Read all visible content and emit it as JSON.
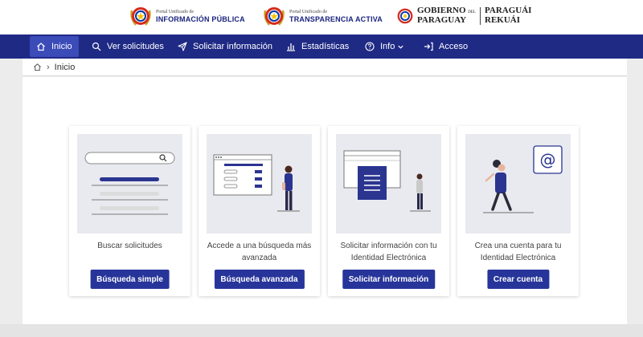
{
  "logos": [
    {
      "small": "Portal Unificado de",
      "big": "INFORMACIÓN PÚBLICA"
    },
    {
      "small": "Portal Unificado de",
      "big": "TRANSPARENCIA ACTIVA"
    }
  ],
  "gov": {
    "line1": "GOBIERNO",
    "line1_small": "DEL",
    "line2": "PARAGUAY",
    "line3": "PARAGUÁI",
    "line4": "REKUÁI"
  },
  "nav": {
    "items": [
      {
        "label": "Inicio",
        "icon": "home-icon"
      },
      {
        "label": "Ver solicitudes",
        "icon": "search-icon"
      },
      {
        "label": "Solicitar información",
        "icon": "send-icon"
      },
      {
        "label": "Estadísticas",
        "icon": "bar-chart-icon"
      },
      {
        "label": "Info",
        "icon": "help-circle-icon"
      },
      {
        "label": "Acceso",
        "icon": "login-icon"
      }
    ]
  },
  "breadcrumb": {
    "current": "Inicio"
  },
  "cards": [
    {
      "text": "Buscar solicitudes",
      "button": "Búsqueda simple"
    },
    {
      "text": "Accede a una búsqueda más avanzada",
      "button": "Búsqueda avanzada"
    },
    {
      "text": "Solicitar información con tu Identidad Electrónica",
      "button": "Solicitar información"
    },
    {
      "text": "Crea una cuenta para tu Identidad Electrónica",
      "button": "Crear cuenta"
    }
  ],
  "colors": {
    "nav_bg": "#1f2a85",
    "nav_active": "#3b4bb8",
    "button": "#27359a"
  }
}
